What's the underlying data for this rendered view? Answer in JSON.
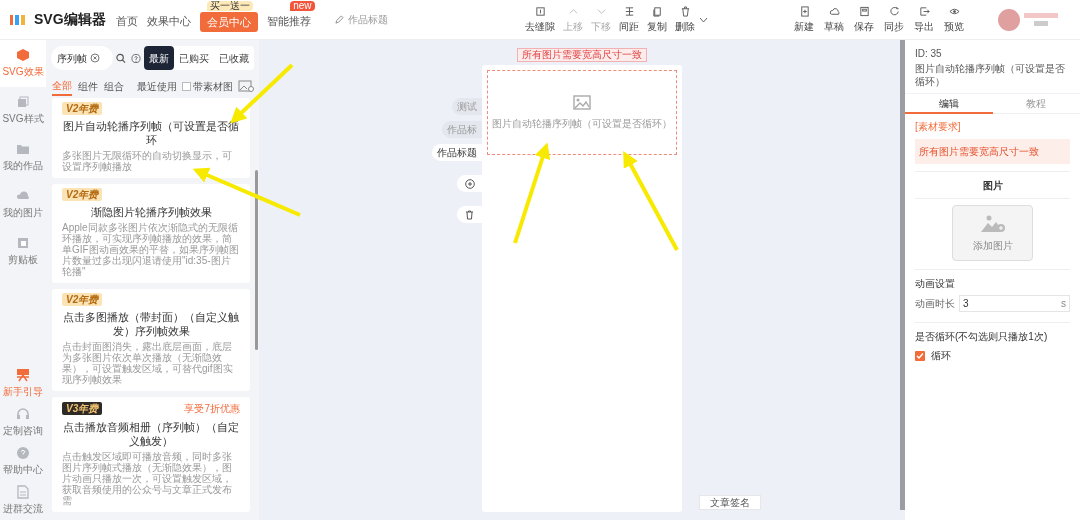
{
  "app": {
    "name": "SVG编辑器"
  },
  "nav": [
    {
      "label": "首页",
      "kind": "link"
    },
    {
      "label": "效果中心",
      "kind": "link"
    },
    {
      "label": "会员中心",
      "kind": "primary",
      "badge": "买一送一"
    },
    {
      "label": "智能推荐",
      "kind": "link",
      "badge": "new"
    }
  ],
  "title_field": {
    "placeholder": "作品标题"
  },
  "toolbar": [
    {
      "label": "去缝隙",
      "disabled": false
    },
    {
      "label": "上移",
      "disabled": true
    },
    {
      "label": "下移",
      "disabled": true
    },
    {
      "label": "间距",
      "disabled": false
    },
    {
      "label": "复制",
      "disabled": false
    },
    {
      "label": "删除",
      "disabled": false
    }
  ],
  "actions": [
    "新建",
    "草稿",
    "保存",
    "同步",
    "导出",
    "预览"
  ],
  "rail": [
    {
      "label": "SVG效果",
      "selected": true
    },
    {
      "label": "SVG样式",
      "selected": false
    },
    {
      "label": "我的作品",
      "selected": false
    },
    {
      "label": "我的图片",
      "selected": false
    },
    {
      "label": "剪贴板",
      "selected": false
    }
  ],
  "rail_bottom": [
    {
      "label": "新手引导",
      "highlighted": true
    },
    {
      "label": "定制咨询",
      "highlighted": false
    },
    {
      "label": "帮助中心",
      "highlighted": false
    },
    {
      "label": "进群交流",
      "highlighted": false
    }
  ],
  "search": {
    "value": "序列帧"
  },
  "segments": [
    {
      "label": "最新",
      "selected": true
    },
    {
      "label": "已购买",
      "selected": false
    },
    {
      "label": "已收藏",
      "selected": false
    }
  ],
  "filters": [
    {
      "label": "全部",
      "selected": true
    },
    {
      "label": "组件",
      "selected": false
    },
    {
      "label": "组合",
      "selected": false
    }
  ],
  "recent": "最近使用",
  "with_material": {
    "label": "带素材图",
    "checked": false
  },
  "cards": [
    {
      "badge": "V2年费",
      "kind": "v2",
      "title": "图片自动轮播序列帧（可设置是否循环",
      "description": "多张图片无限循环的自动切换显示，可设置序列帧播放"
    },
    {
      "badge": "V2年费",
      "kind": "v2",
      "title": "渐隐图片轮播序列帧效果",
      "description": "Apple同款多张图片依次渐隐式的无限循环播放，可实现序列帧播放的效果，简单GIF图动画效果的平替，如果序列帧图片数量过多出现闪退请使用\"id:35-图片轮播\""
    },
    {
      "badge": "V2年费",
      "kind": "v2",
      "title": "点击多图播放（带封面）（自定义触发）序列帧效果",
      "description": "点击封面图消失，露出底层画面，底层为多张图片依次单次播放（无渐隐效果），可设置触发区域，可替代gif图实现序列帧效果"
    },
    {
      "badge": "V3年费",
      "kind": "v3",
      "promo": "享受7折优惠",
      "title": "点击播放音频相册（序列帧）（自定义触发）",
      "description": "点击触发区域即可播放音频，同时多张图片序列帧式播放（无渐隐效果），图片动画只播放一次，可设置触发区域，获取音频使用的公众号与文章正式发布需"
    }
  ],
  "canvas": {
    "notice": "所有图片需要宽高尺寸一致",
    "side_tabs": [
      {
        "label": "测试",
        "selected": false
      },
      {
        "label": "作品标",
        "selected": false
      },
      {
        "label": "作品标题",
        "selected": true
      }
    ],
    "placeholder": "图片自动轮播序列帧（可设置是否循环）",
    "footer_button": "文章签名"
  },
  "panel": {
    "id": "ID: 35",
    "title": "图片自动轮播序列帧（可设置是否循环）",
    "tabs": [
      {
        "label": "编辑",
        "selected": true
      },
      {
        "label": "教程",
        "selected": false
      }
    ],
    "requirement_label": "[素材要求]",
    "requirement": "所有图片需要宽高尺寸一致",
    "image_heading": "图片",
    "add_image": "添加图片",
    "animation_heading": "动画设置",
    "duration_label": "动画时长",
    "duration": "3",
    "unit": "s",
    "loop_heading": "是否循环(不勾选则只播放1次)",
    "loop": {
      "label": "循环",
      "checked": true
    }
  }
}
